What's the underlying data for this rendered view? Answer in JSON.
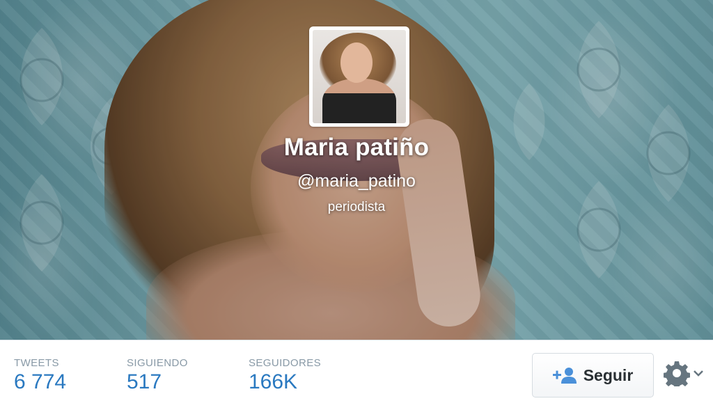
{
  "profile": {
    "name": "Maria patiño",
    "handle": "@maria_patino",
    "bio": "periodista"
  },
  "stats": [
    {
      "label": "TWEETS",
      "value": "6 774"
    },
    {
      "label": "SIGUIENDO",
      "value": "517"
    },
    {
      "label": "SEGUIDORES",
      "value": "166K"
    }
  ],
  "actions": {
    "follow_label": "Seguir",
    "follow_icon": "add-user-icon",
    "settings_icon": "gear-icon",
    "dropdown_icon": "chevron-down-icon"
  },
  "colors": {
    "stat_value": "#2a79c0",
    "stat_label": "#8899a6",
    "follow_icon": "#4a90d9"
  }
}
